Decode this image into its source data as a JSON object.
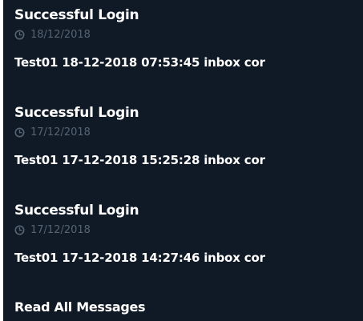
{
  "notifications": [
    {
      "title": "Successful Login",
      "date": "18/12/2018",
      "message": "Test01 18-12-2018 07:53:45 inbox cor"
    },
    {
      "title": "Successful Login",
      "date": "17/12/2018",
      "message": "Test01 17-12-2018 15:25:28 inbox cor"
    },
    {
      "title": "Successful Login",
      "date": "17/12/2018",
      "message": "Test01 17-12-2018 14:27:46 inbox cor"
    }
  ],
  "footer": {
    "read_all_label": "Read All Messages"
  },
  "icons": {
    "date_icon": "clock-icon"
  },
  "colors": {
    "panel_background": "#101a27",
    "text_primary": "#ffffff",
    "text_muted": "#566471"
  }
}
